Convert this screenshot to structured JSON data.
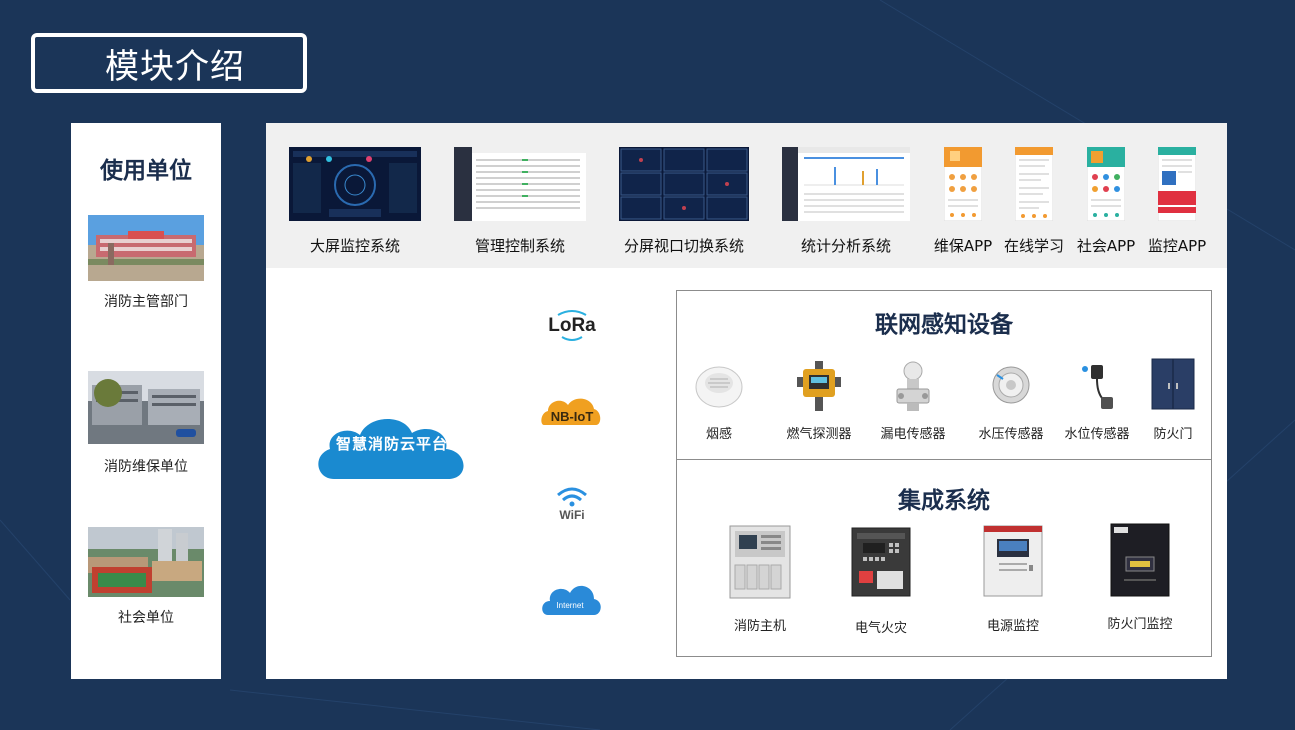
{
  "page": {
    "title": "模块介绍"
  },
  "left": {
    "title": "使用单位",
    "units": [
      {
        "label": "消防主管部门"
      },
      {
        "label": "消防维保单位"
      },
      {
        "label": "社会单位"
      }
    ]
  },
  "systems": [
    {
      "label": "大屏监控系统"
    },
    {
      "label": "管理控制系统"
    },
    {
      "label": "分屏视口切换系统"
    },
    {
      "label": "统计分析系统"
    },
    {
      "label": "维保APP"
    },
    {
      "label": "在线学习"
    },
    {
      "label": "社会APP"
    },
    {
      "label": "监控APP"
    }
  ],
  "cloud": {
    "label": "智慧消防云平台"
  },
  "protocols": [
    {
      "label": "LoRa"
    },
    {
      "label": "NB-IoT"
    },
    {
      "label": "WiFi"
    },
    {
      "label": "Internet"
    }
  ],
  "sensing": {
    "title": "联网感知设备",
    "devices": [
      {
        "label": "烟感"
      },
      {
        "label": "燃气探测器"
      },
      {
        "label": "漏电传感器"
      },
      {
        "label": "水压传感器"
      },
      {
        "label": "水位传感器"
      },
      {
        "label": "防火门"
      }
    ]
  },
  "integration": {
    "title": "集成系统",
    "devices": [
      {
        "label": "消防主机"
      },
      {
        "label": "电气火灾"
      },
      {
        "label": "电源监控"
      },
      {
        "label": "防火门监控"
      }
    ]
  },
  "colors": {
    "background": "#1b3558",
    "title_text": "#1b2e4d",
    "cloud": "#1a8ad0",
    "band": "#f0f0f0"
  }
}
